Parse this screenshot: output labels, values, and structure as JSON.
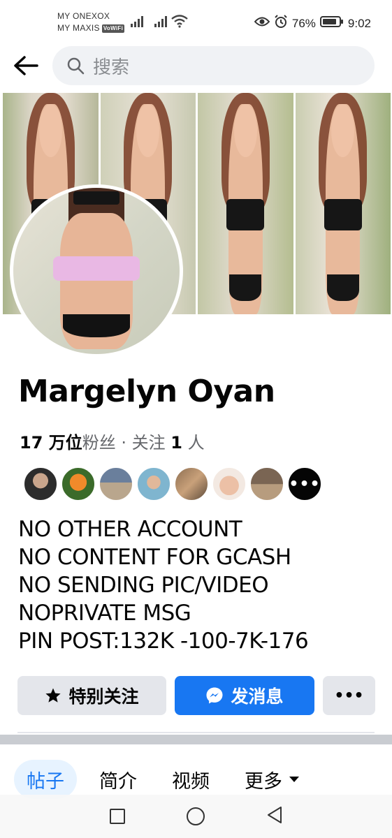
{
  "status_bar": {
    "carrier_1": "MY ONEXOX",
    "carrier_2": "MY MAXIS",
    "vowifi_badge": "VoWiFi",
    "battery": "76%",
    "time": "9:02"
  },
  "search": {
    "placeholder": "搜索"
  },
  "profile": {
    "name": "Margelyn Oyan",
    "followers_count": "17 万位",
    "followers_label": "粉丝",
    "separator": " · ",
    "following_label": "关注 ",
    "following_count": "1",
    "following_unit": " 人",
    "more_friends_label": "•••",
    "bio_lines": [
      "NO OTHER ACCOUNT",
      "NO CONTENT FOR GCASH",
      "NO SENDING PIC/VIDEO",
      "NOPRIVATE MSG",
      "PIN POST:132K -100-7K-176"
    ]
  },
  "actions": {
    "follow_label": "特别关注",
    "message_label": "发消息",
    "more_label": "•••"
  },
  "tabs": [
    "帖子",
    "简介",
    "视频",
    "更多"
  ],
  "colors": {
    "brand_blue": "#1877f2",
    "button_grey": "#e4e6eb",
    "active_tab_bg": "#e7f3ff"
  }
}
